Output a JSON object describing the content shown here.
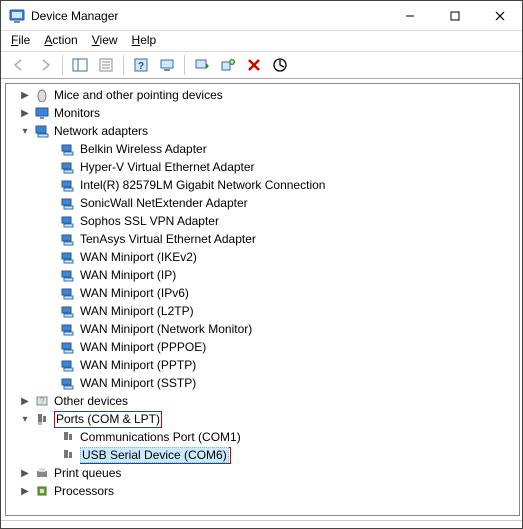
{
  "window": {
    "title": "Device Manager"
  },
  "menu": {
    "file": "File",
    "action": "Action",
    "view": "View",
    "help": "Help"
  },
  "toolbar": {
    "back": "Back",
    "forward": "Forward",
    "show_hide": "Show/Hide Console Tree",
    "properties": "Properties",
    "help": "Help",
    "scan": "Scan for hardware changes",
    "update": "Update driver",
    "uninstall": "Uninstall device",
    "disable": "Disable device",
    "add_legacy": "Add legacy hardware"
  },
  "tree": {
    "mice": "Mice and other pointing devices",
    "monitors": "Monitors",
    "network_adapters": "Network adapters",
    "net": {
      "belkin": "Belkin Wireless Adapter",
      "hyperv": "Hyper-V Virtual Ethernet Adapter",
      "intel": "Intel(R) 82579LM Gigabit Network Connection",
      "sonicwall": "SonicWall NetExtender Adapter",
      "sophos": "Sophos SSL VPN Adapter",
      "tenasys": "TenAsys Virtual Ethernet Adapter",
      "wan_ikev2": "WAN Miniport (IKEv2)",
      "wan_ip": "WAN Miniport (IP)",
      "wan_ipv6": "WAN Miniport (IPv6)",
      "wan_l2tp": "WAN Miniport (L2TP)",
      "wan_netmon": "WAN Miniport (Network Monitor)",
      "wan_pppoe": "WAN Miniport (PPPOE)",
      "wan_pptp": "WAN Miniport (PPTP)",
      "wan_sstp": "WAN Miniport (SSTP)"
    },
    "other_devices": "Other devices",
    "ports": "Ports (COM & LPT)",
    "port": {
      "com1": "Communications Port (COM1)",
      "usb_serial": "USB Serial Device (COM6)"
    },
    "print_queues": "Print queues",
    "processors": "Processors"
  }
}
